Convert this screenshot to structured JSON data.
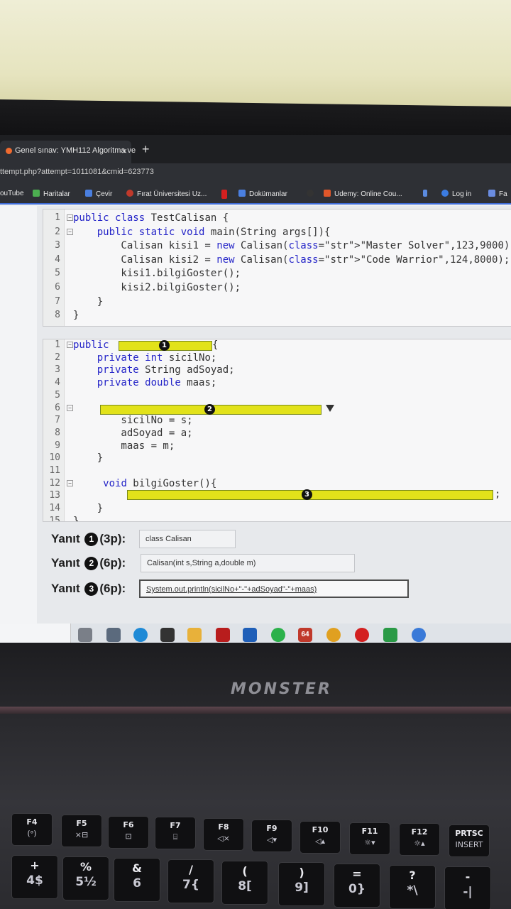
{
  "browser": {
    "tab_title": "Genel sınav: YMH112 Algoritma ve",
    "tab_close": "×",
    "new_tab": "+",
    "url": "ttempt.php?attempt=1011081&cmid=623773",
    "bookmarks": [
      "ouTube",
      "Haritalar",
      "Çevir",
      "Fırat Üniversitesi Uz...",
      "Dokümanlar",
      "Udemy: Online Cou...",
      "Log in",
      "Fa"
    ]
  },
  "code1": {
    "lines": [
      {
        "n": "1",
        "fold": "⊟",
        "text": "public class TestCalisan {"
      },
      {
        "n": "2",
        "fold": "⊟",
        "text": "    public static void main(String args[]){"
      },
      {
        "n": "3",
        "fold": "",
        "text": "        Calisan kisi1 = new Calisan(\"Master Solver\",123,9000);"
      },
      {
        "n": "4",
        "fold": "",
        "text": "        Calisan kisi2 = new Calisan(\"Code Warrior\",124,8000);"
      },
      {
        "n": "5",
        "fold": "",
        "text": "        kisi1.bilgiGoster();"
      },
      {
        "n": "6",
        "fold": "",
        "text": "        kisi2.bilgiGoster();"
      },
      {
        "n": "7",
        "fold": "",
        "text": "    }"
      },
      {
        "n": "8",
        "fold": "",
        "text": "}"
      }
    ]
  },
  "code2": {
    "lines": [
      {
        "n": "1",
        "fold": "⊟",
        "text": "public"
      },
      {
        "n": "2",
        "fold": "",
        "text": "    private int sicilNo;"
      },
      {
        "n": "3",
        "fold": "",
        "text": "    private String adSoyad;"
      },
      {
        "n": "4",
        "fold": "",
        "text": "    private double maas;"
      },
      {
        "n": "5",
        "fold": "",
        "text": ""
      },
      {
        "n": "6",
        "fold": "⊟",
        "text": ""
      },
      {
        "n": "7",
        "fold": "",
        "text": "        sicilNo = s;"
      },
      {
        "n": "8",
        "fold": "",
        "text": "        adSoyad = a;"
      },
      {
        "n": "9",
        "fold": "",
        "text": "        maas = m;"
      },
      {
        "n": "10",
        "fold": "",
        "text": "    }"
      },
      {
        "n": "11",
        "fold": "",
        "text": ""
      },
      {
        "n": "12",
        "fold": "⊟",
        "text": "     void bilgiGoster(){"
      },
      {
        "n": "13",
        "fold": "",
        "text": ""
      },
      {
        "n": "14",
        "fold": "",
        "text": "    }"
      },
      {
        "n": "15",
        "fold": "",
        "text": "}"
      }
    ],
    "brace_after_blank1": "{",
    "semicolon_after_blank3": ";",
    "markers": [
      "1",
      "2",
      "3"
    ]
  },
  "answers": [
    {
      "label": "Yanıt",
      "num": "1",
      "points": "(3p):",
      "value": "class Calisan"
    },
    {
      "label": "Yanıt",
      "num": "2",
      "points": "(6p):",
      "value": "Calisan(int s,String a,double m)"
    },
    {
      "label": "Yanıt",
      "num": "3",
      "points": "(6p):",
      "value": "System.out.println(sicilNo+\"-\"+adSoyad\"-\"+maas)"
    }
  ],
  "taskbar": {
    "badge": "64"
  },
  "laptop": {
    "brand": "MONSTER"
  },
  "keyboard": {
    "fn_row": [
      {
        "k1": "F4",
        "k2": "(ᵊ)"
      },
      {
        "k1": "F5",
        "k2": "×⊟"
      },
      {
        "k1": "F6",
        "k2": "⊡"
      },
      {
        "k1": "F7",
        "k2": "⌸"
      },
      {
        "k1": "F8",
        "k2": "◁×"
      },
      {
        "k1": "F9",
        "k2": "◁▾"
      },
      {
        "k1": "F10",
        "k2": "◁▴"
      },
      {
        "k1": "F11",
        "k2": "☼▾"
      },
      {
        "k1": "F12",
        "k2": "☼▴"
      },
      {
        "k1": "PRTSC",
        "k2": "INSERT"
      }
    ],
    "num_row": [
      {
        "k1": "+",
        "k2": "4$"
      },
      {
        "k1": "%",
        "k2": "5½"
      },
      {
        "k1": "&",
        "k2": "6"
      },
      {
        "k1": "/",
        "k2": "7{"
      },
      {
        "k1": "(",
        "k2": "8["
      },
      {
        "k1": ")",
        "k2": "9]"
      },
      {
        "k1": "=",
        "k2": "0}"
      },
      {
        "k1": "?",
        "k2": "*\\"
      },
      {
        "k1": "-",
        "k2": "-|"
      }
    ]
  }
}
